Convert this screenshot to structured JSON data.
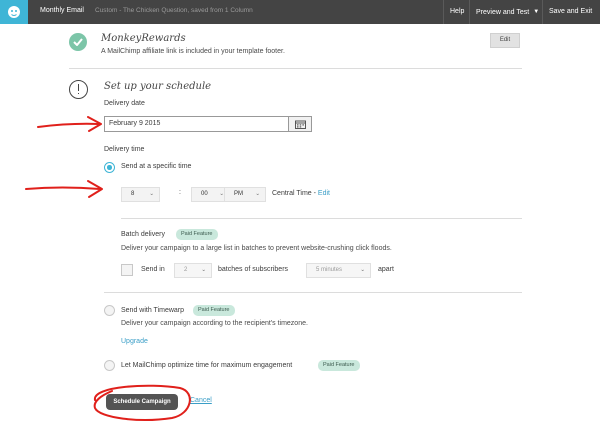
{
  "topbar": {
    "title": "Monthly Email",
    "subtitle": "Custom - The Chicken Question, saved from 1 Column",
    "help": "Help",
    "preview": "Preview and Test",
    "save_exit": "Save and Exit"
  },
  "rewards": {
    "title": "MonkeyRewards",
    "description": "A MailChimp affiliate link is included in your template footer.",
    "edit_label": "Edit"
  },
  "schedule": {
    "title": "Set up your schedule",
    "delivery_date_label": "Delivery date",
    "date_value": "February 9 2015",
    "delivery_time_label": "Delivery time",
    "specific_time_label": "Send at a specific time",
    "hour": "8",
    "minute": "00",
    "ampm": "PM",
    "timezone": "Central Time -",
    "timezone_edit": "Edit",
    "batch": {
      "title": "Batch delivery",
      "badge": "Paid Feature",
      "description": "Deliver your campaign to a large list in batches to prevent website-crushing click floods.",
      "send_in": "Send in",
      "count": "2",
      "batches_label": "batches of subscribers",
      "interval": "5 minutes",
      "apart": "apart"
    },
    "timewarp": {
      "title": "Send with Timewarp",
      "badge": "Paid Feature",
      "description": "Deliver your campaign according to the recipient's timezone.",
      "upgrade": "Upgrade"
    },
    "optimize": {
      "title": "Let MailChimp optimize time for maximum engagement",
      "badge": "Paid Feature"
    },
    "schedule_button": "Schedule Campaign",
    "cancel": "Cancel"
  },
  "colors": {
    "accent": "#3fb5d6",
    "annotation": "#e0201b",
    "badge_bg": "#c9e8dc"
  }
}
